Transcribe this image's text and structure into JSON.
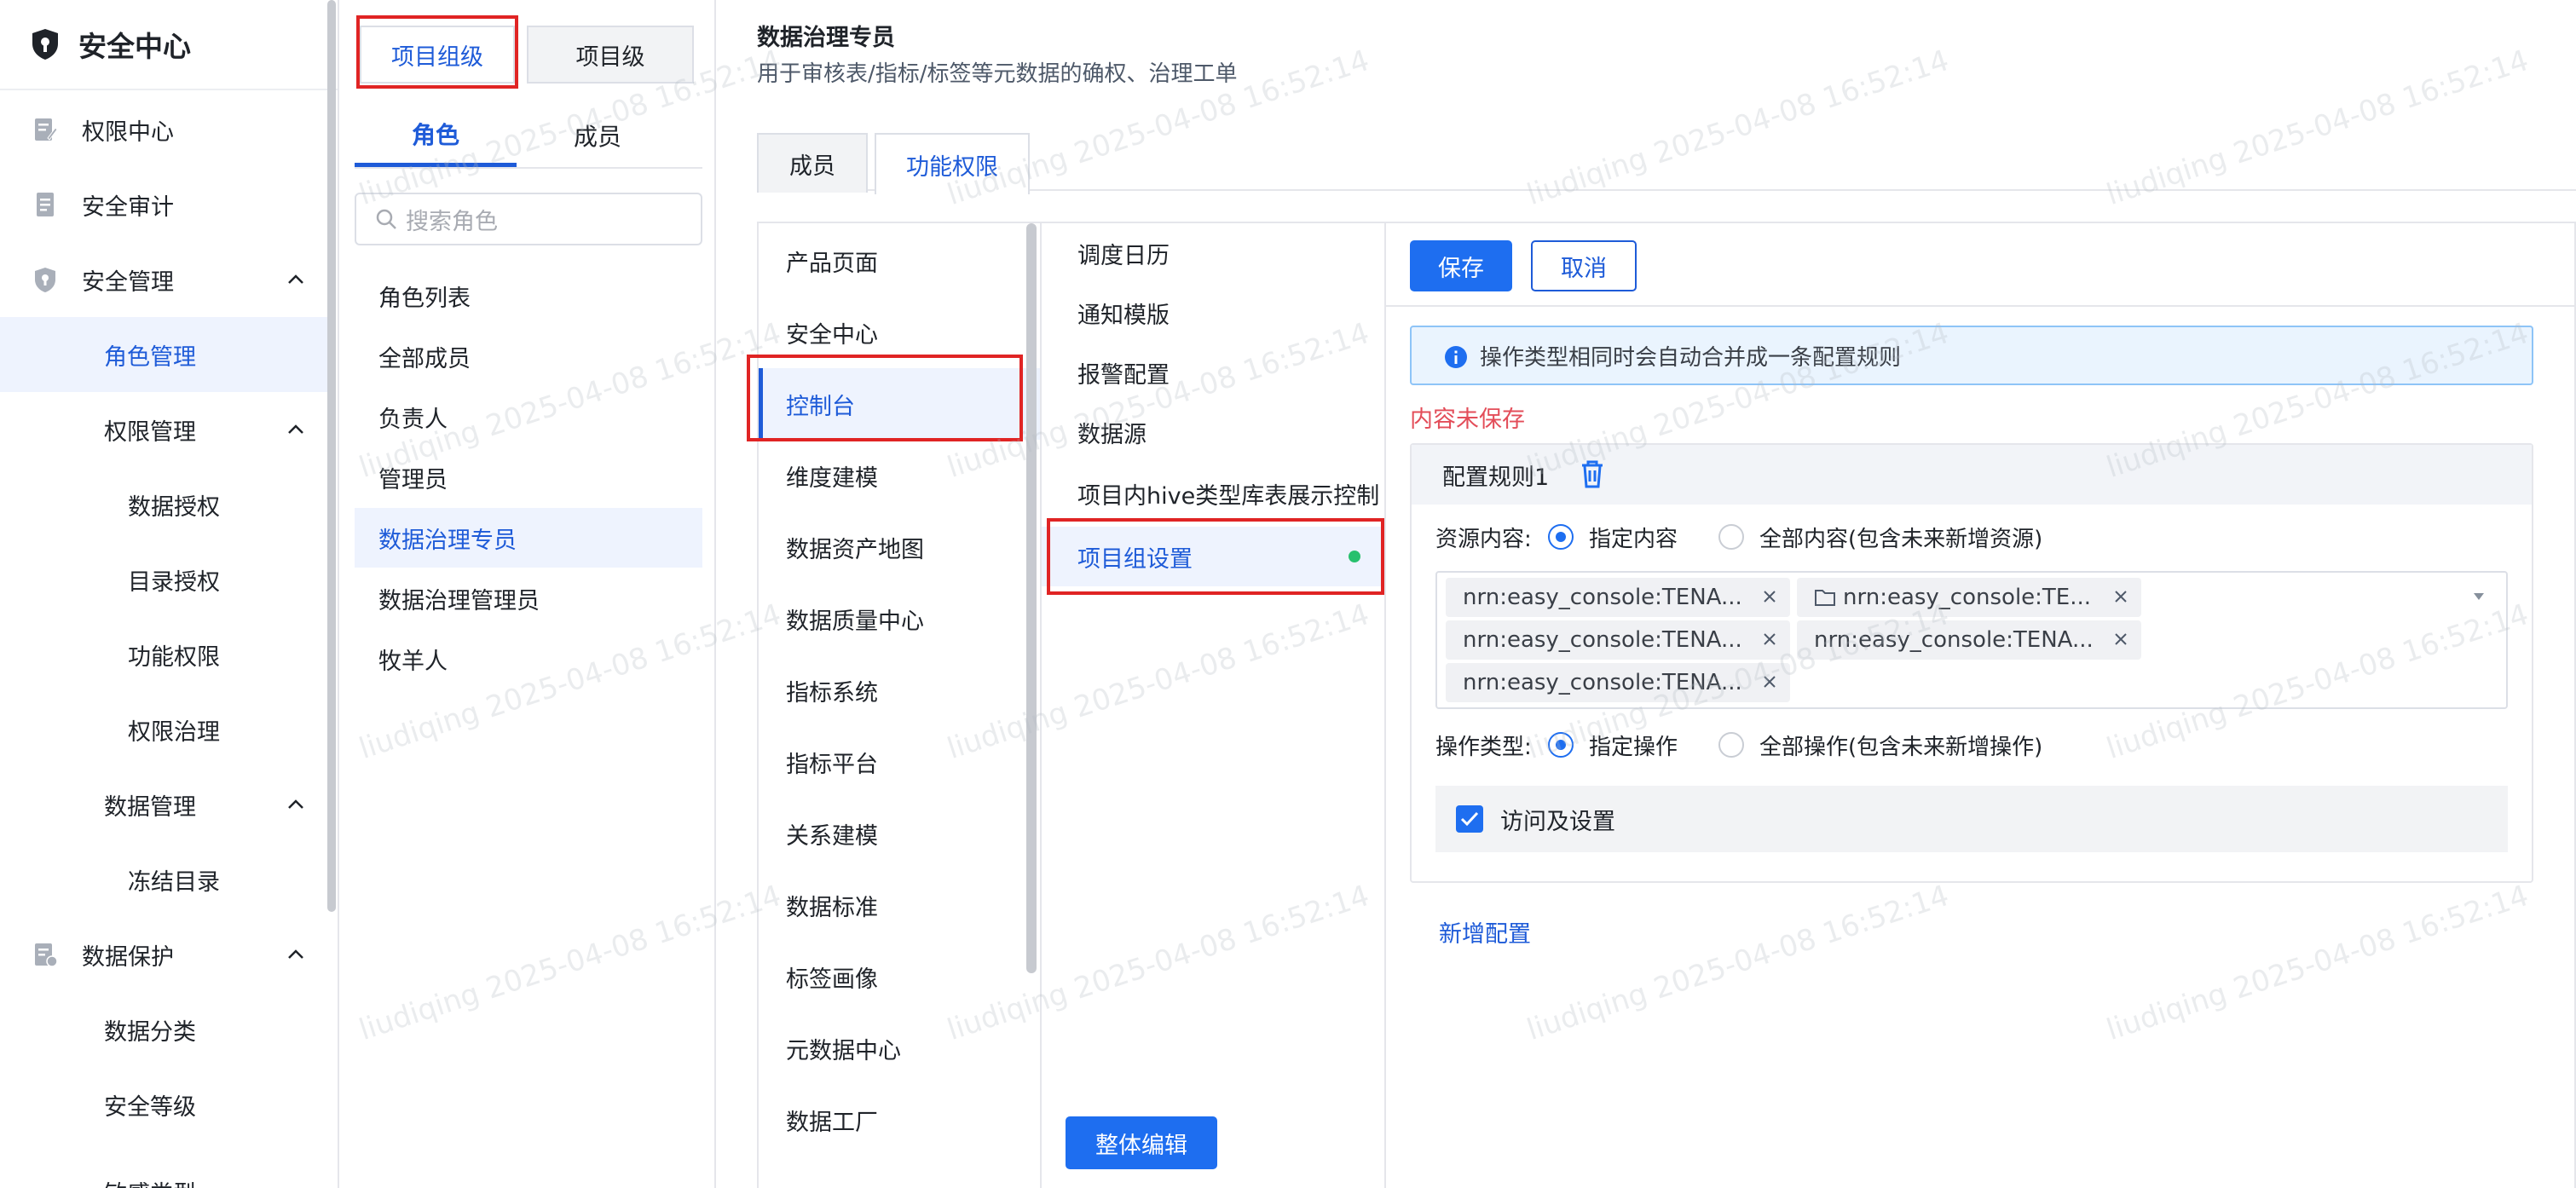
{
  "sidebar": {
    "app_title": "安全中心",
    "items": [
      {
        "label": "权限中心",
        "icon": "edit-doc-icon"
      },
      {
        "label": "安全审计",
        "icon": "document-icon"
      },
      {
        "label": "安全管理",
        "icon": "shield-icon",
        "expanded": true
      },
      {
        "label": "角色管理",
        "active": true
      },
      {
        "label": "权限管理",
        "expanded": true
      },
      {
        "label": "数据授权"
      },
      {
        "label": "目录授权"
      },
      {
        "label": "功能权限"
      },
      {
        "label": "权限治理"
      },
      {
        "label": "数据管理",
        "expanded": true
      },
      {
        "label": "冻结目录"
      },
      {
        "label": "数据保护",
        "icon": "data-protect-icon",
        "expanded": true
      },
      {
        "label": "数据分类"
      },
      {
        "label": "安全等级"
      },
      {
        "label": "敏感类型"
      }
    ]
  },
  "roles_panel": {
    "scope_tabs": [
      "项目组级",
      "项目级"
    ],
    "active_scope": "项目组级",
    "sub_tabs": [
      "角色",
      "成员"
    ],
    "active_sub_tab": "角色",
    "search_placeholder": "搜索角色",
    "roles": [
      "角色列表",
      "全部成员",
      "负责人",
      "管理员",
      "数据治理专员",
      "数据治理管理员",
      "牧羊人"
    ],
    "active_role": "数据治理专员"
  },
  "main": {
    "title": "数据治理专员",
    "description": "用于审核表/指标/标签等元数据的确权、治理工单",
    "tabs": [
      "成员",
      "功能权限"
    ],
    "active_tab": "功能权限",
    "products": [
      "产品页面",
      "安全中心",
      "控制台",
      "维度建模",
      "数据资产地图",
      "数据质量中心",
      "指标系统",
      "指标平台",
      "关系建模",
      "数据标准",
      "标签画像",
      "元数据中心",
      "数据工厂"
    ],
    "active_product": "控制台",
    "functions": [
      "调度日历",
      "通知模版",
      "报警配置",
      "数据源",
      "项目内hive类型库表展示控制",
      "项目组设置"
    ],
    "active_function": "项目组设置",
    "bulk_edit_label": "整体编辑",
    "save_label": "保存",
    "cancel_label": "取消",
    "info_text": "操作类型相同时会自动合并成一条配置规则",
    "unsaved_text": "内容未保存",
    "rule": {
      "title": "配置规则1",
      "resource_label": "资源内容:",
      "resource_options": [
        "指定内容",
        "全部内容(包含未来新增资源)"
      ],
      "resource_selected": "指定内容",
      "tags": [
        {
          "text": "nrn:easy_console:TENA...",
          "folder": false
        },
        {
          "text": "nrn:easy_console:TE...",
          "folder": true
        },
        {
          "text": "nrn:easy_console:TENA...",
          "folder": false
        },
        {
          "text": "nrn:easy_console:TENA...",
          "folder": false
        },
        {
          "text": "nrn:easy_console:TENA...",
          "folder": false
        }
      ],
      "operation_label": "操作类型:",
      "operation_options": [
        "指定操作",
        "全部操作(包含未来新增操作)"
      ],
      "operation_selected": "指定操作",
      "checkbox_label": "访问及设置",
      "checkbox_checked": true
    },
    "add_config_label": "新增配置"
  },
  "watermark": "liudiqing 2025-04-08 16:52:14",
  "colors": {
    "primary": "#1e6ef0",
    "active_text": "#1e5bd8",
    "active_bg": "#eef3fe",
    "annotation_red": "#e02424",
    "unsaved_red": "#e34d59",
    "status_dot": "#27c06e"
  }
}
